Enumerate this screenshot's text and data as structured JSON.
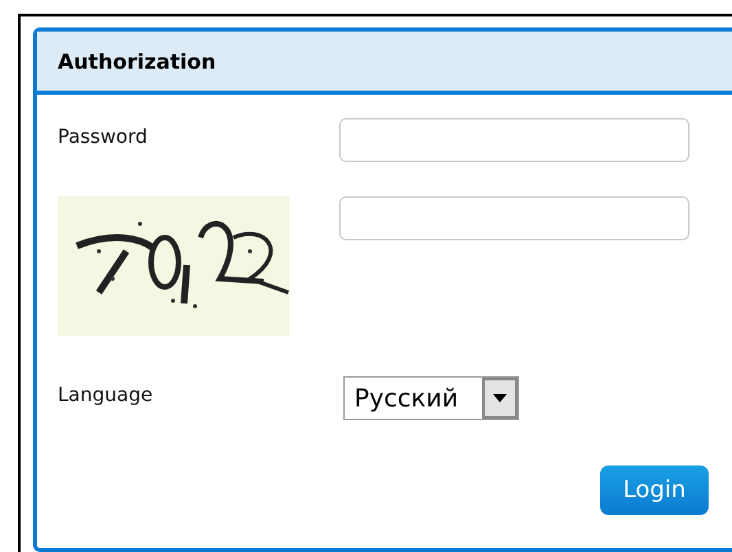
{
  "panel": {
    "title": "Authorization"
  },
  "fields": [
    {
      "kind": "password",
      "label": "Password"
    },
    {
      "kind": "captcha"
    }
  ],
  "language": {
    "label": "Language",
    "value": "Русский"
  },
  "buttons": [
    "Login"
  ]
}
